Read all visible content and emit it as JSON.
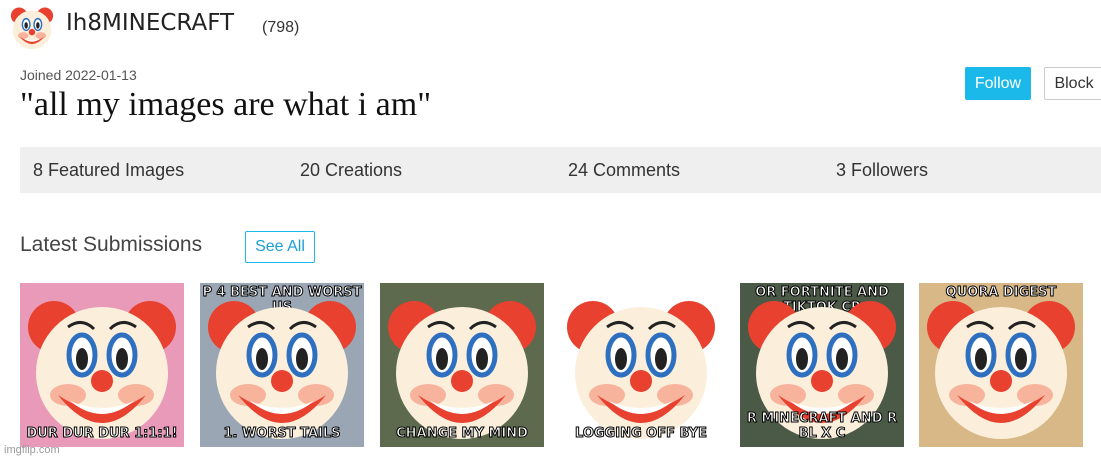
{
  "profile": {
    "avatar_icon": "clown-face-icon",
    "username": "Ih8MINECRAFT",
    "points": "(798)",
    "joined": "Joined 2022-01-13",
    "tagline": "\"all my images are what i am\""
  },
  "actions": {
    "follow_label": "Follow",
    "block_label": "Block"
  },
  "stats": [
    {
      "label": "8 Featured Images"
    },
    {
      "label": "20 Creations"
    },
    {
      "label": "24 Comments"
    },
    {
      "label": "3 Followers"
    }
  ],
  "latest": {
    "title": "Latest Submissions",
    "see_all_label": "See All"
  },
  "thumbnails": [
    {
      "top_caption": "",
      "bottom_caption": "dur dur dur 1:1:1!",
      "bg": "#e89ab8",
      "overlay_icon": "clown-face-icon"
    },
    {
      "top_caption": "P 4 BEST AND WORST US",
      "bottom_caption": "1. WORST TAILS",
      "bg": "#9aa6b4",
      "overlay_icon": "clown-face-icon"
    },
    {
      "top_caption": "",
      "bottom_caption": "CHANGE MY MIND",
      "bg": "#5d6a4e",
      "overlay_icon": "clown-face-icon"
    },
    {
      "top_caption": "",
      "bottom_caption": "LOGGING OFF BYE",
      "bg": "#ffffff",
      "overlay_icon": "clown-face-icon"
    },
    {
      "top_caption": "OR FORTNITE AND TIKTOK CR",
      "bottom_caption": "R MINECRAFT AND R BL X C",
      "bg": "#4b5a46",
      "overlay_icon": "clown-face-icon"
    },
    {
      "top_caption": "Quora Digest",
      "bottom_caption": "",
      "bg": "#d8b887",
      "overlay_icon": "clown-face-icon"
    }
  ],
  "footer": {
    "watermark": "imgflip.com"
  },
  "colors": {
    "accent": "#1bb9ea",
    "stats_bg": "#efefef"
  }
}
